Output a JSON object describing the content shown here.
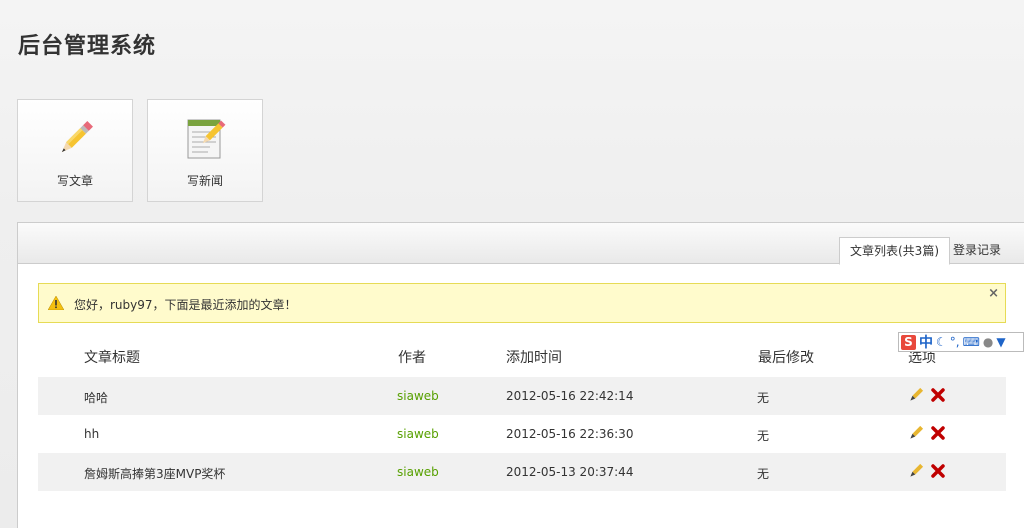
{
  "app": {
    "title": "后台管理系统"
  },
  "shortcuts": [
    {
      "label": "写文章",
      "icon": "pencil-icon"
    },
    {
      "label": "写新闻",
      "icon": "notepad-pencil-icon"
    }
  ],
  "tabs": [
    {
      "label": "文章列表(共3篇)",
      "active": true
    },
    {
      "label": "登录记录",
      "active": false
    }
  ],
  "notice": {
    "message": "您好，ruby97，下面是最近添加的文章！",
    "close": "×"
  },
  "table": {
    "headers": [
      "文章标题",
      "作者",
      "添加时间",
      "最后修改",
      "选项"
    ],
    "rows": [
      {
        "title": "哈哈",
        "author": "siaweb",
        "added": "2012-05-16 22:42:14",
        "modified": "无"
      },
      {
        "title": "hh",
        "author": "siaweb",
        "added": "2012-05-16 22:36:30",
        "modified": "无"
      },
      {
        "title": "詹姆斯高捧第3座MVP奖杯",
        "author": "siaweb",
        "added": "2012-05-13 20:37:44",
        "modified": "无"
      }
    ]
  },
  "ime_toolbar": {
    "logo": "S",
    "mode": "中",
    "icons": [
      "moon-icon",
      "punctuation-icon",
      "keyboard-icon",
      "user-icon",
      "shirt-icon"
    ]
  },
  "colors": {
    "author": "#57a000",
    "notice_bg": "#fffbcc",
    "notice_border": "#e6db55",
    "delete": "#c00000",
    "edit": "#d8a028"
  }
}
